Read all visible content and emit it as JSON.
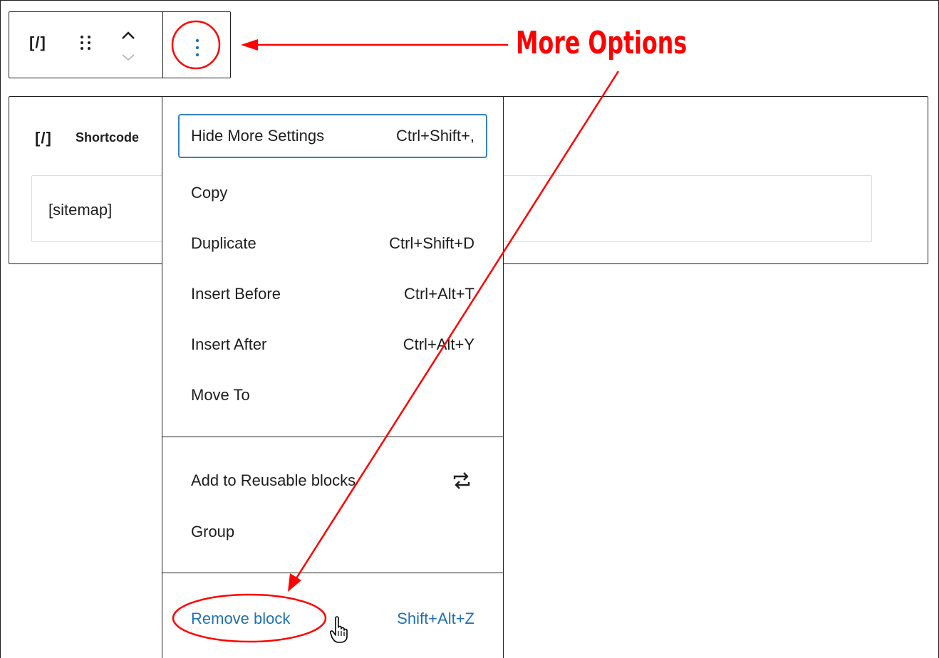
{
  "toolbar": {
    "block_type_icon": "[/]",
    "drag_handle_icon": "drag-handle-icon",
    "move_up_icon": "chevron-up-icon",
    "move_down_icon": "chevron-down-icon",
    "more_options_icon": "vertical-ellipsis-icon"
  },
  "block": {
    "icon": "[/]",
    "title": "Shortcode",
    "input_value": "[sitemap]"
  },
  "menu": {
    "items": [
      {
        "label": "Hide More Settings",
        "shortcut": "Ctrl+Shift+,"
      },
      {
        "label": "Copy",
        "shortcut": ""
      },
      {
        "label": "Duplicate",
        "shortcut": "Ctrl+Shift+D"
      },
      {
        "label": "Insert Before",
        "shortcut": "Ctrl+Alt+T"
      },
      {
        "label": "Insert After",
        "shortcut": "Ctrl+Alt+Y"
      },
      {
        "label": "Move To",
        "shortcut": ""
      }
    ],
    "reusable": {
      "label": "Add to Reusable blocks",
      "icon": "reusable-icon"
    },
    "group": {
      "label": "Group"
    },
    "remove": {
      "label": "Remove block",
      "shortcut": "Shift+Alt+Z"
    }
  },
  "annotation": {
    "text": "More Options",
    "color": "#ff0000"
  },
  "colors": {
    "focus": "#3582c4",
    "link": "#2271b1",
    "annotation": "#ff0000"
  }
}
